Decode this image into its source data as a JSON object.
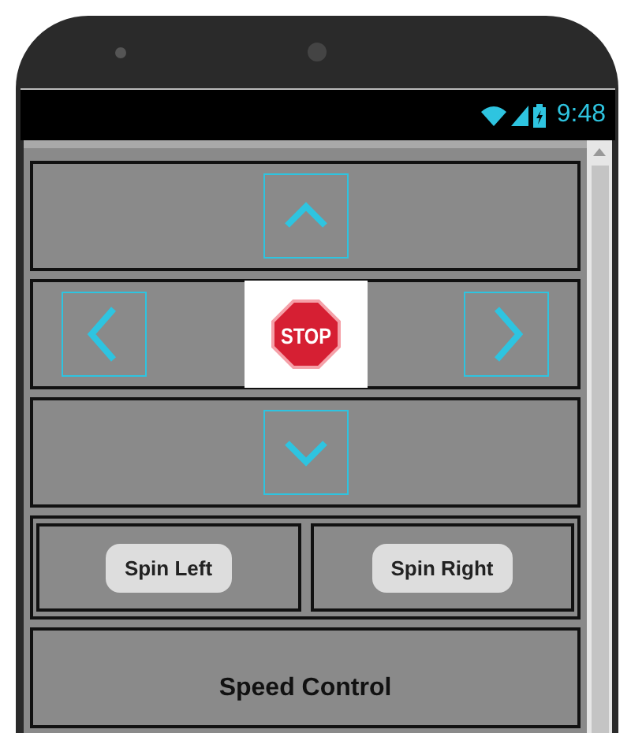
{
  "status_bar": {
    "time": "9:48"
  },
  "stop_button": {
    "label": "STOP"
  },
  "spin_buttons": [
    {
      "label": "Spin Left"
    },
    {
      "label": "Spin Right"
    }
  ],
  "speed_label": "Speed Control"
}
